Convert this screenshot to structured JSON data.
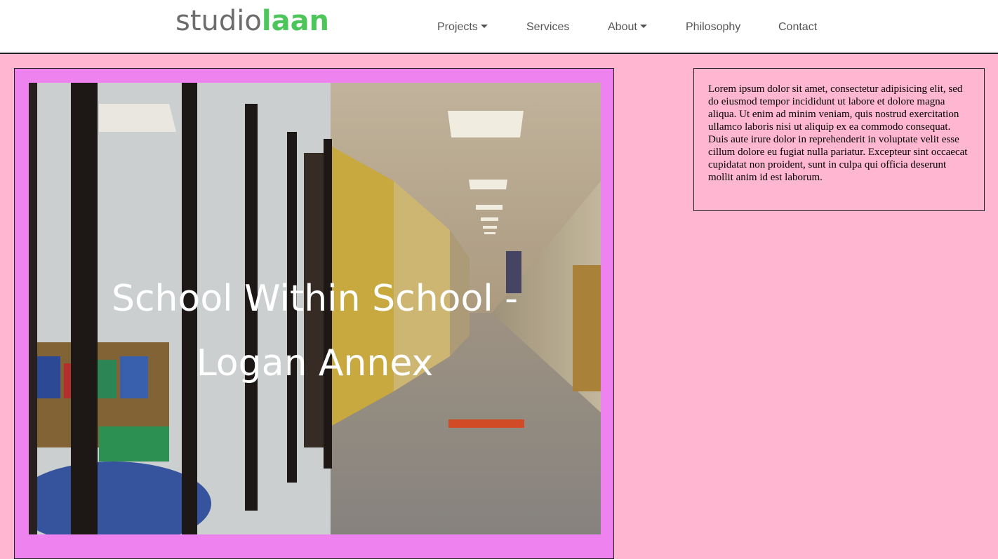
{
  "brand": {
    "logo_part1": "studio",
    "logo_part2": "laan",
    "logo_colors": {
      "part1": "#6d6d6d",
      "part2": "#4cc65a"
    }
  },
  "nav": {
    "items": [
      {
        "label": "Projects",
        "has_dropdown": true
      },
      {
        "label": "Services",
        "has_dropdown": false
      },
      {
        "label": "About",
        "has_dropdown": true
      },
      {
        "label": "Philosophy",
        "has_dropdown": false
      },
      {
        "label": "Contact",
        "has_dropdown": false
      }
    ]
  },
  "project": {
    "title_line1": "School Within School -",
    "title_line2": "Logan Annex",
    "image_subject": "school hallway photo"
  },
  "sidebar": {
    "description": "Lorem ipsum dolor sit amet, consectetur adipisicing elit, sed do eiusmod tempor incididunt ut labore et dolore magna aliqua. Ut enim ad minim veniam, quis nostrud exercitation ullamco laboris nisi ut aliquip ex ea commodo consequat. Duis aute irure dolor in reprehenderit in voluptate velit esse cillum dolore eu fugiat nulla pariatur. Excepteur sint occaecat cupidatat non proident, sunt in culpa qui officia deserunt mollit anim id est laborum."
  },
  "colors": {
    "page_background": "#ffb6d0",
    "card_background": "#ee82ee",
    "nav_text": "#555555"
  }
}
